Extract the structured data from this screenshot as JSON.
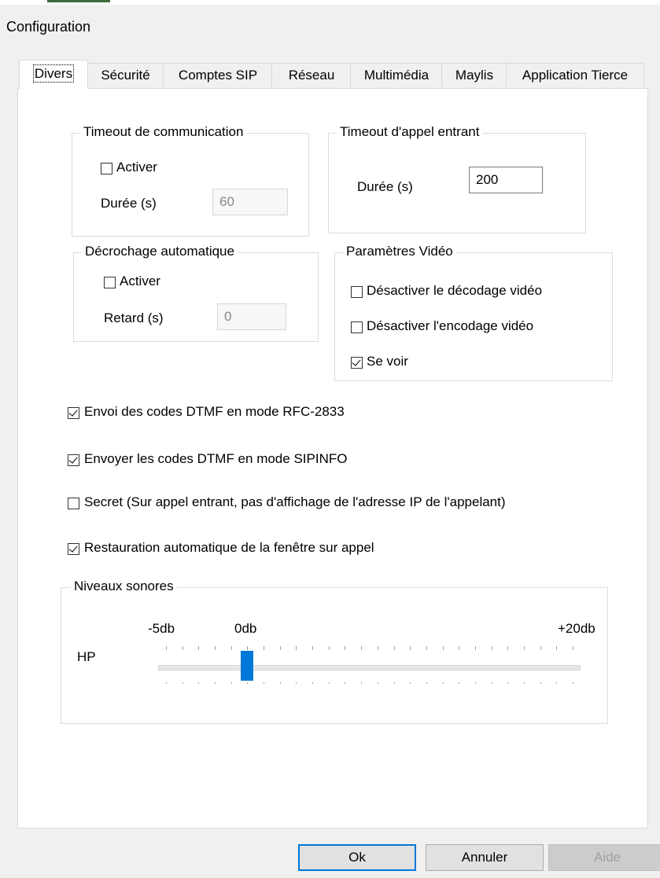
{
  "window": {
    "title": "Configuration"
  },
  "tabs": [
    {
      "label": "Divers",
      "active": true
    },
    {
      "label": "Sécurité"
    },
    {
      "label": "Comptes SIP"
    },
    {
      "label": "Réseau"
    },
    {
      "label": "Multimédia"
    },
    {
      "label": "Maylis"
    },
    {
      "label": "Application Tierce"
    }
  ],
  "timeout_comm": {
    "legend": "Timeout de communication",
    "enable_label": "Activer",
    "enable_checked": false,
    "duration_label": "Durée (s)",
    "duration_value": "60"
  },
  "timeout_incoming": {
    "legend": "Timeout d'appel entrant",
    "duration_label": "Durée (s)",
    "duration_value": "200"
  },
  "auto_answer": {
    "legend": "Décrochage automatique",
    "enable_label": "Activer",
    "enable_checked": false,
    "delay_label": "Retard (s)",
    "delay_value": "0"
  },
  "video": {
    "legend": "Paramètres Vidéo",
    "disable_decoding_label": "Désactiver le décodage vidéo",
    "disable_decoding_checked": false,
    "disable_encoding_label": "Désactiver l'encodage vidéo",
    "disable_encoding_checked": false,
    "self_view_label": "Se voir",
    "self_view_checked": true
  },
  "options": {
    "dtmf_rfc_label": "Envoi des codes DTMF en mode RFC-2833",
    "dtmf_rfc_checked": true,
    "dtmf_sipinfo_label": "Envoyer les codes DTMF en mode SIPINFO",
    "dtmf_sipinfo_checked": true,
    "secret_label": "Secret (Sur appel entrant, pas d'affichage de l'adresse IP de l'appelant)",
    "secret_checked": false,
    "restore_label": "Restauration automatique de la fenêtre sur appel",
    "restore_checked": true
  },
  "sound": {
    "legend": "Niveaux sonores",
    "min_label": "-5db",
    "mid_label": "0db",
    "max_label": "+20db",
    "hp_label": "HP",
    "hp_value_db": 0
  },
  "buttons": {
    "ok": "Ok",
    "cancel": "Annuler",
    "help": "Aide"
  }
}
